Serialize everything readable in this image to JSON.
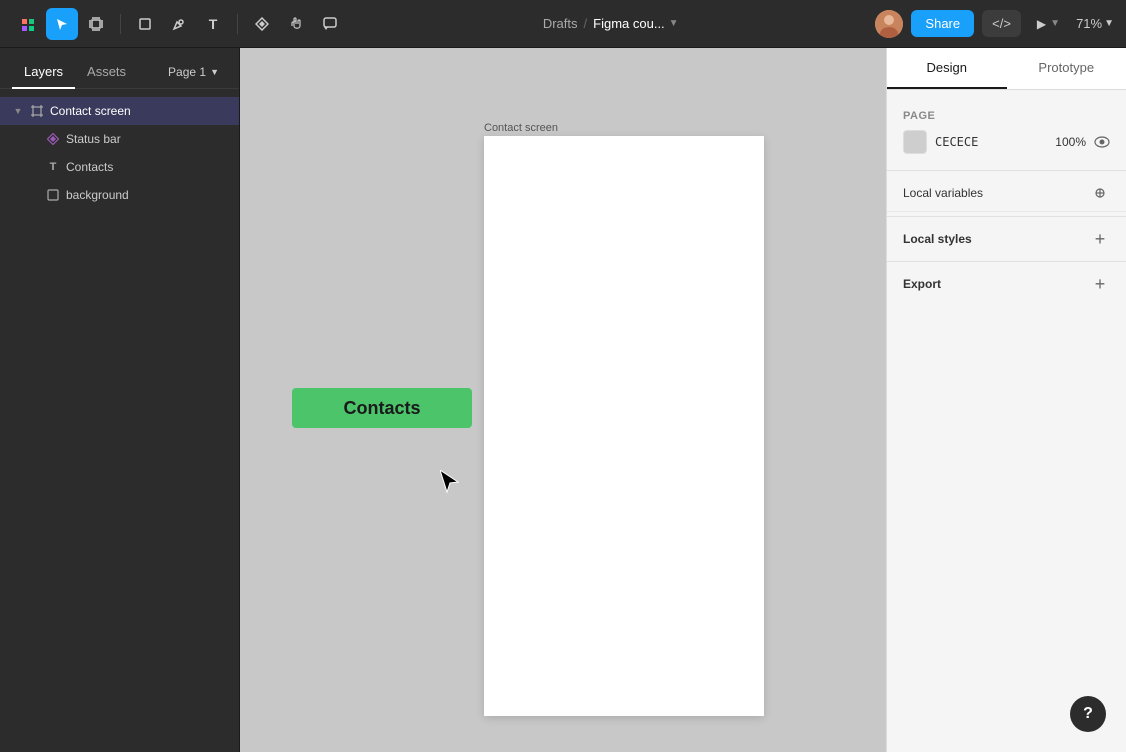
{
  "toolbar": {
    "move_tool_label": "▲",
    "drafts_label": "Drafts",
    "separator": "/",
    "file_label": "Figma cou...",
    "share_label": "Share",
    "code_label": "</>",
    "zoom_label": "71%",
    "play_label": "▶"
  },
  "left_panel": {
    "tabs": [
      {
        "id": "layers",
        "label": "Layers"
      },
      {
        "id": "assets",
        "label": "Assets"
      }
    ],
    "active_tab": "layers",
    "page_selector": "Page 1",
    "layers": [
      {
        "id": "contact-screen",
        "label": "Contact screen",
        "indent": 0,
        "icon": "frame",
        "has_chevron": true,
        "selected": true
      },
      {
        "id": "status-bar",
        "label": "Status bar",
        "indent": 1,
        "icon": "component",
        "has_chevron": false
      },
      {
        "id": "contacts",
        "label": "Contacts",
        "indent": 1,
        "icon": "text",
        "has_chevron": false
      },
      {
        "id": "background",
        "label": "background",
        "indent": 1,
        "icon": "rect",
        "has_chevron": false
      }
    ]
  },
  "canvas": {
    "frame_label": "Contact screen",
    "contacts_chip_label": "Contacts"
  },
  "right_panel": {
    "tabs": [
      {
        "id": "design",
        "label": "Design"
      },
      {
        "id": "prototype",
        "label": "Prototype"
      }
    ],
    "active_tab": "design",
    "page_section_label": "Page",
    "page_color_hex": "CECECE",
    "page_color_opacity": "100%",
    "local_variables_label": "Local variables",
    "local_styles_label": "Local styles",
    "export_label": "Export"
  }
}
